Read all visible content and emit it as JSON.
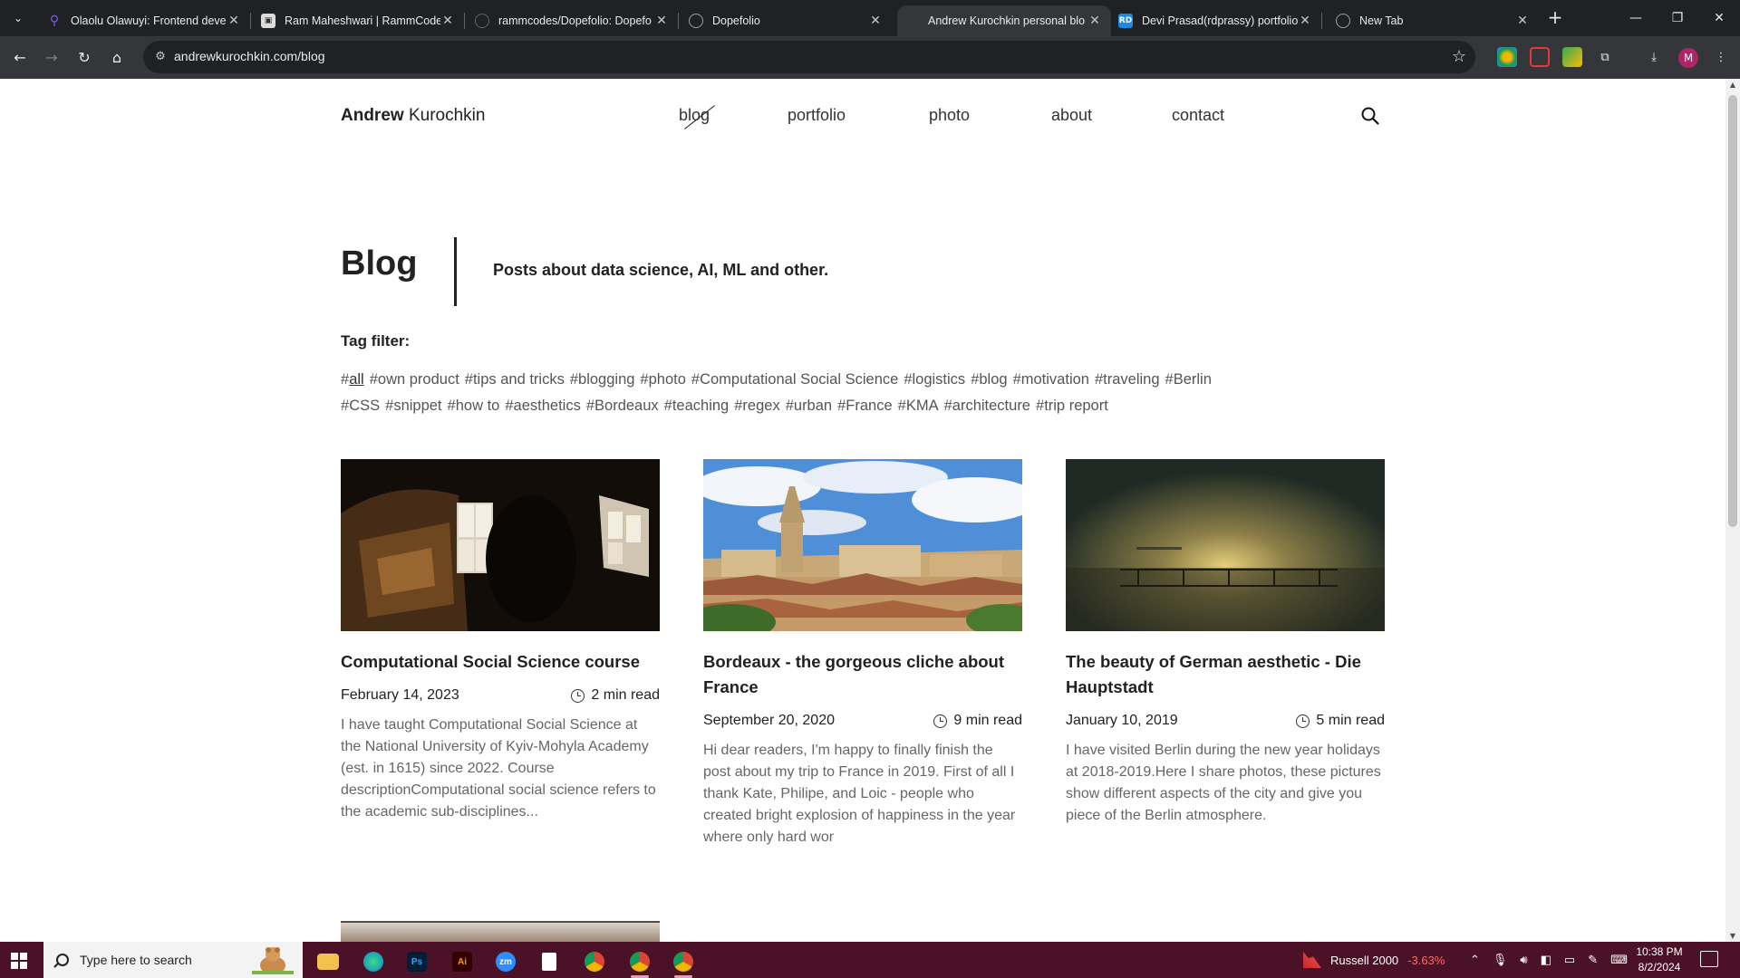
{
  "browser": {
    "tabs": [
      {
        "title": "Olaolu Olawuyi: Frontend deve",
        "favicon_color": "#5b3fd6",
        "favicon": "pin-icon"
      },
      {
        "title": "Ram Maheshwari | RammCodes",
        "favicon_color": "#ffffff",
        "favicon": "portrait-icon"
      },
      {
        "title": "rammcodes/Dopefolio: Dopefo",
        "favicon_color": "#202124",
        "favicon": "github-icon"
      },
      {
        "title": "Dopefolio",
        "favicon_color": "#5f6368",
        "favicon": "globe-icon"
      },
      {
        "title": "Andrew Kurochkin personal blo",
        "favicon_color": "#35363a",
        "favicon": "blank-icon"
      },
      {
        "title": "Devi Prasad(rdprassy) portfolio",
        "favicon_color": "#1e88e5",
        "favicon": "rd-icon",
        "favicon_text": "RD"
      },
      {
        "title": "New Tab",
        "favicon_color": "#5f6368",
        "favicon": "chrome-icon"
      }
    ],
    "active_tab_index": 4,
    "url": "andrewkurochkin.com/blog"
  },
  "site": {
    "brand_first": "Andrew",
    "brand_last": "Kurochkin",
    "nav": [
      "blog",
      "portfolio",
      "photo",
      "about",
      "contact"
    ],
    "active_nav": "blog",
    "heading": "Blog",
    "subheading": "Posts about data science, AI, ML and other.",
    "tag_filter_label": "Tag filter:",
    "tags": [
      "all",
      "own product",
      "tips and tricks",
      "blogging",
      "photo",
      "Computational Social Science",
      "logistics",
      "blog",
      "motivation",
      "traveling",
      "Berlin",
      "CSS",
      "snippet",
      "how to",
      "aesthetics",
      "Bordeaux",
      "teaching",
      "regex",
      "urban",
      "France",
      "KMA",
      "architecture",
      "trip report"
    ],
    "selected_tag": "all",
    "posts": [
      {
        "title": "Computational Social Science course",
        "date": "February 14, 2023",
        "read_time": "2 min read",
        "excerpt": "I have taught Computational Social Science at the National University of Kyiv-Mohyla Academy (est. in 1615) since 2022. Course descriptionComputational social science refers to the academic sub-disciplines..."
      },
      {
        "title": "Bordeaux - the gorgeous cliche about France",
        "date": "September 20, 2020",
        "read_time": "9 min read",
        "excerpt": "Hi dear readers, I'm happy to finally finish the post about my trip to France in 2019. First of all I thank Kate, Philipe, and Loic - people who created bright explosion of happiness in the year where only hard wor"
      },
      {
        "title": "The beauty of German aesthetic - Die Hauptstadt",
        "date": "January 10, 2019",
        "read_time": "5 min read",
        "excerpt": "I have visited Berlin during the new year holidays at 2018-2019.Here I share photos, these pictures show different aspects of the city and give you piece of the Berlin atmosphere."
      }
    ]
  },
  "taskbar": {
    "search_placeholder": "Type here to search",
    "ticker_name": "Russell 2000",
    "ticker_change": "-3.63%",
    "time": "10:38 PM",
    "date": "8/2/2024",
    "apps": [
      "file-explorer-icon",
      "edge-icon",
      "photoshop-icon",
      "illustrator-icon",
      "zoom-icon",
      "file-icon",
      "chrome-icon",
      "chrome-profile-icon",
      "chrome-alt-icon"
    ]
  },
  "colors": {
    "tab_strip": "#202124",
    "toolbar": "#35363a",
    "taskbar": "#4b1227",
    "ticker_negative": "#ff6b6b"
  }
}
